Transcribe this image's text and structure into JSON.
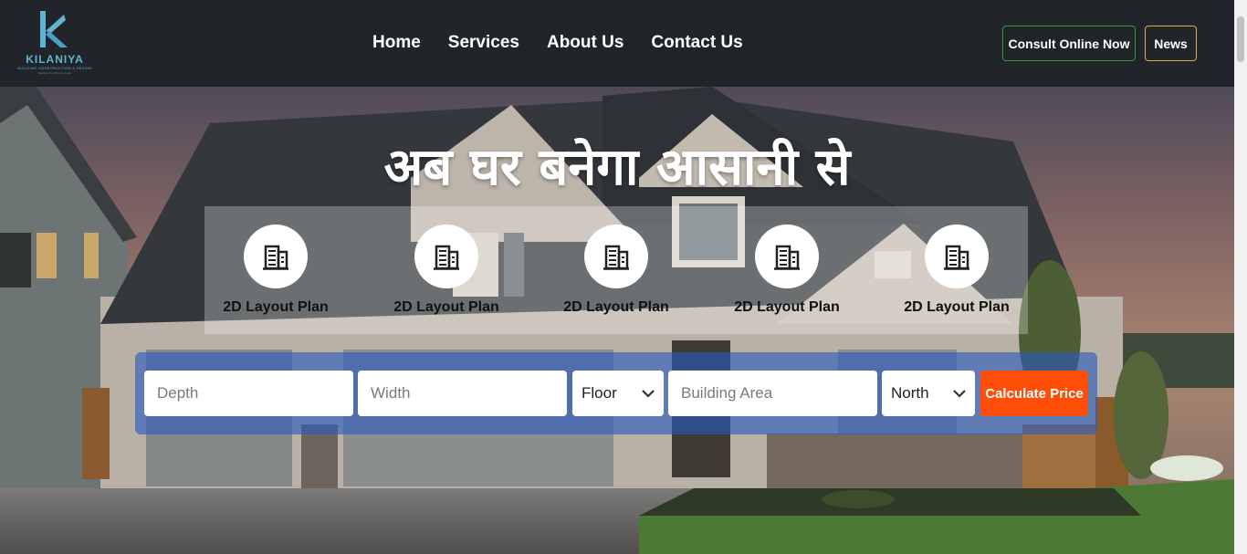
{
  "header": {
    "logo": {
      "name": "KILANIYA",
      "subtitle": "BUILDING CONSTRUCTION & DESIGN",
      "tagline": "Building Your Dream Home"
    },
    "nav": [
      {
        "label": "Home"
      },
      {
        "label": "Services"
      },
      {
        "label": "About Us"
      },
      {
        "label": "Contact Us"
      }
    ],
    "consult_button": "Consult Online Now",
    "news_button": "News"
  },
  "hero": {
    "headline": "अब घर बनेगा आसानी से",
    "features": [
      {
        "label": "2D Layout Plan",
        "icon": "building-icon"
      },
      {
        "label": "2D Layout Plan",
        "icon": "building-icon"
      },
      {
        "label": "2D Layout Plan",
        "icon": "building-icon"
      },
      {
        "label": "2D Layout Plan",
        "icon": "building-icon"
      },
      {
        "label": "2D Layout Plan",
        "icon": "building-icon"
      }
    ]
  },
  "calculator": {
    "depth_placeholder": "Depth",
    "width_placeholder": "Width",
    "floor_value": "Floor",
    "area_placeholder": "Building Area",
    "direction_value": "North",
    "submit_label": "Calculate Price"
  },
  "colors": {
    "header_bg": "#212429",
    "consult_border": "#2d9a3f",
    "news_border": "#e2a94b",
    "calc_panel": "#2c5abe",
    "calc_button": "#ff4d0a"
  }
}
